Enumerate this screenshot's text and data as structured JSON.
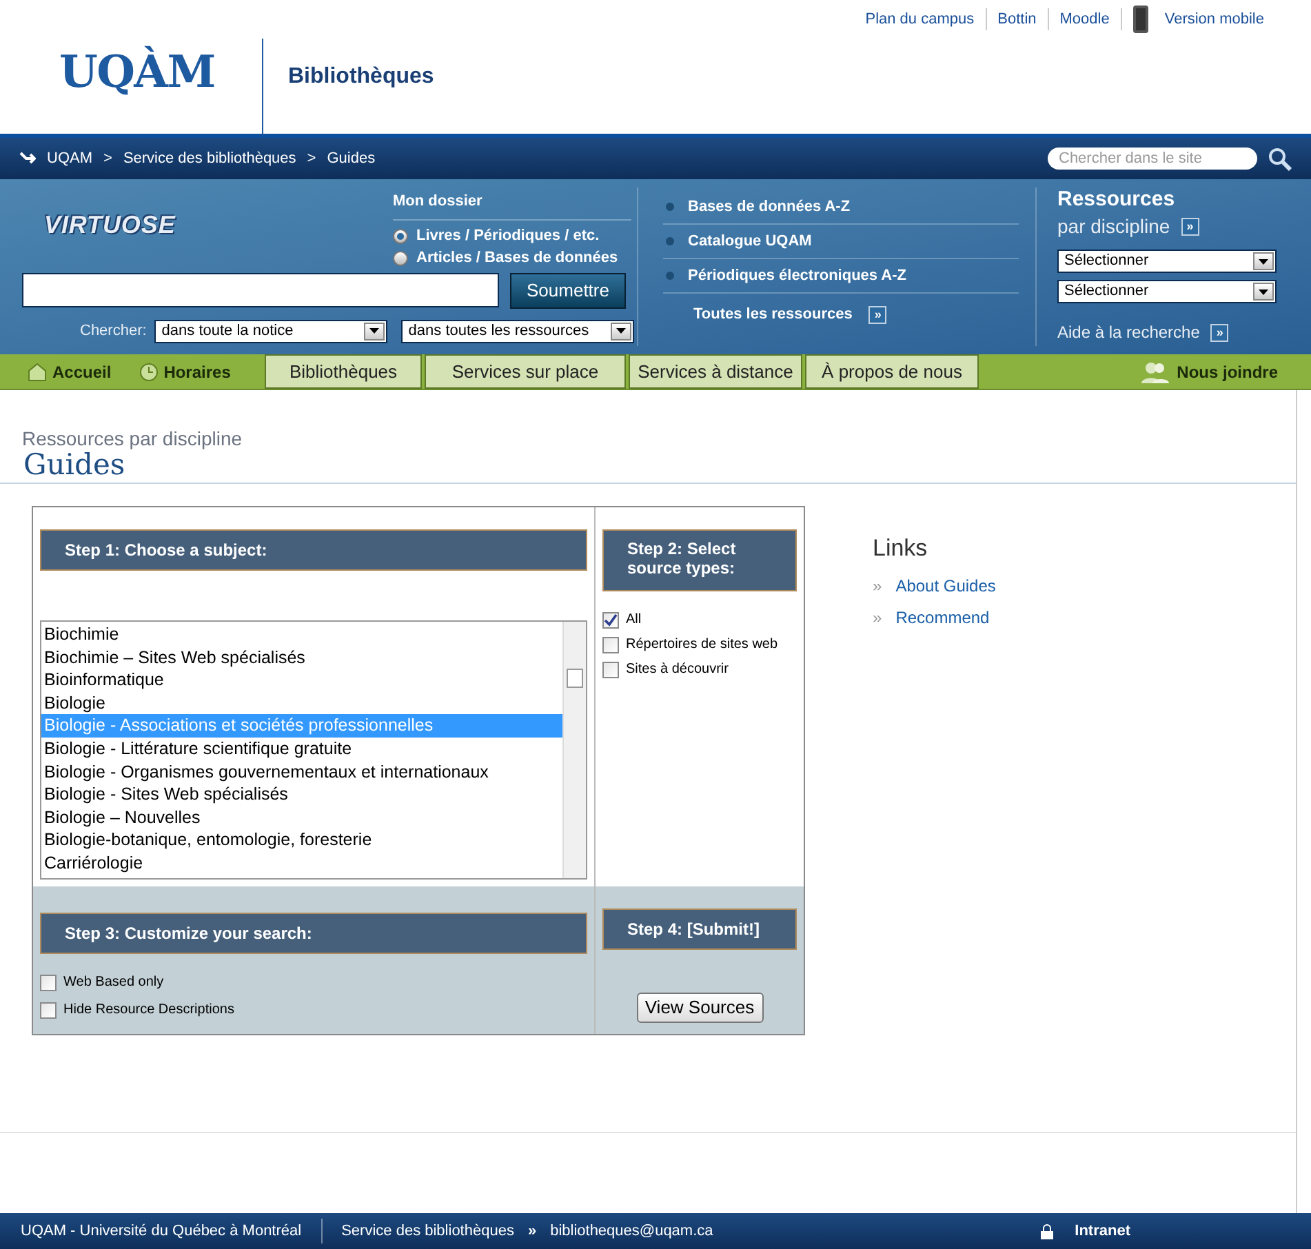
{
  "top_links": [
    "Plan du campus",
    "Bottin",
    "Moodle",
    "Version mobile"
  ],
  "logo": "UQÀM",
  "site_title": "Bibliothèques",
  "breadcrumb": [
    "UQAM",
    "Service des bibliothèques",
    "Guides"
  ],
  "breadcrumb_separator": ">",
  "site_search": {
    "placeholder": "Chercher dans le site"
  },
  "catalog": {
    "logo": "VIRTUOSE",
    "heading": "Mon dossier",
    "radios": [
      {
        "label": "Livres / Périodiques / etc.",
        "selected": true
      },
      {
        "label": "Articles / Bases de données",
        "selected": false
      }
    ],
    "submit": "Soumettre",
    "search_label": "Chercher:",
    "selects": [
      "dans toute la notice",
      "dans toutes les ressources"
    ]
  },
  "quick_links": [
    "Bases de données A-Z",
    "Catalogue UQAM",
    "Périodiques électroniques A-Z"
  ],
  "all_resources": "Toutes les ressources",
  "more_mark": "»",
  "resources": {
    "title": "Ressources",
    "subtitle": "par discipline",
    "selects": [
      "Sélectionner",
      "Sélectionner"
    ],
    "help": "Aide à la recherche"
  },
  "nav": {
    "left": [
      "Accueil",
      "Horaires"
    ],
    "tabs": [
      "Bibliothèques",
      "Services sur place",
      "Services à distance",
      "À propos de nous"
    ],
    "right": "Nous joindre"
  },
  "page": {
    "kicker": "Ressources par discipline",
    "title": "Guides"
  },
  "step1": {
    "title": "Step 1: Choose a subject:",
    "items": [
      {
        "label": "Biochimie",
        "selected": false
      },
      {
        "label": "Biochimie – Sites Web spécialisés",
        "selected": false
      },
      {
        "label": "Bioinformatique",
        "selected": false
      },
      {
        "label": "Biologie",
        "selected": false
      },
      {
        "label": "Biologie - Associations et sociétés professionnelles",
        "selected": true
      },
      {
        "label": "Biologie - Littérature scientifique gratuite",
        "selected": false
      },
      {
        "label": "Biologie - Organismes gouvernementaux et internationaux",
        "selected": false
      },
      {
        "label": "Biologie - Sites Web spécialisés",
        "selected": false
      },
      {
        "label": "Biologie – Nouvelles",
        "selected": false
      },
      {
        "label": "Biologie-botanique, entomologie, foresterie",
        "selected": false
      },
      {
        "label": "Carriérologie",
        "selected": false
      }
    ]
  },
  "step2": {
    "title": "Step 2: Select source types:",
    "options": [
      {
        "label": "All",
        "checked": true
      },
      {
        "label": "Répertoires de sites web",
        "checked": false
      },
      {
        "label": "Sites à découvrir",
        "checked": false
      }
    ]
  },
  "step3": {
    "title": "Step 3: Customize your search:",
    "options": [
      {
        "label": "Web Based only",
        "checked": false
      },
      {
        "label": "Hide Resource Descriptions",
        "checked": false
      }
    ]
  },
  "step4": {
    "title": "Step 4: [Submit!]",
    "button": "View Sources"
  },
  "links": {
    "title": "Links",
    "mark": "»",
    "items": [
      "About Guides",
      "Recommend"
    ]
  },
  "footer": {
    "university": "UQAM - Université du Québec à Montréal",
    "service": "Service des bibliothèques",
    "mark": "»",
    "email": "bibliotheques@uqam.ca",
    "intranet": "Intranet"
  }
}
